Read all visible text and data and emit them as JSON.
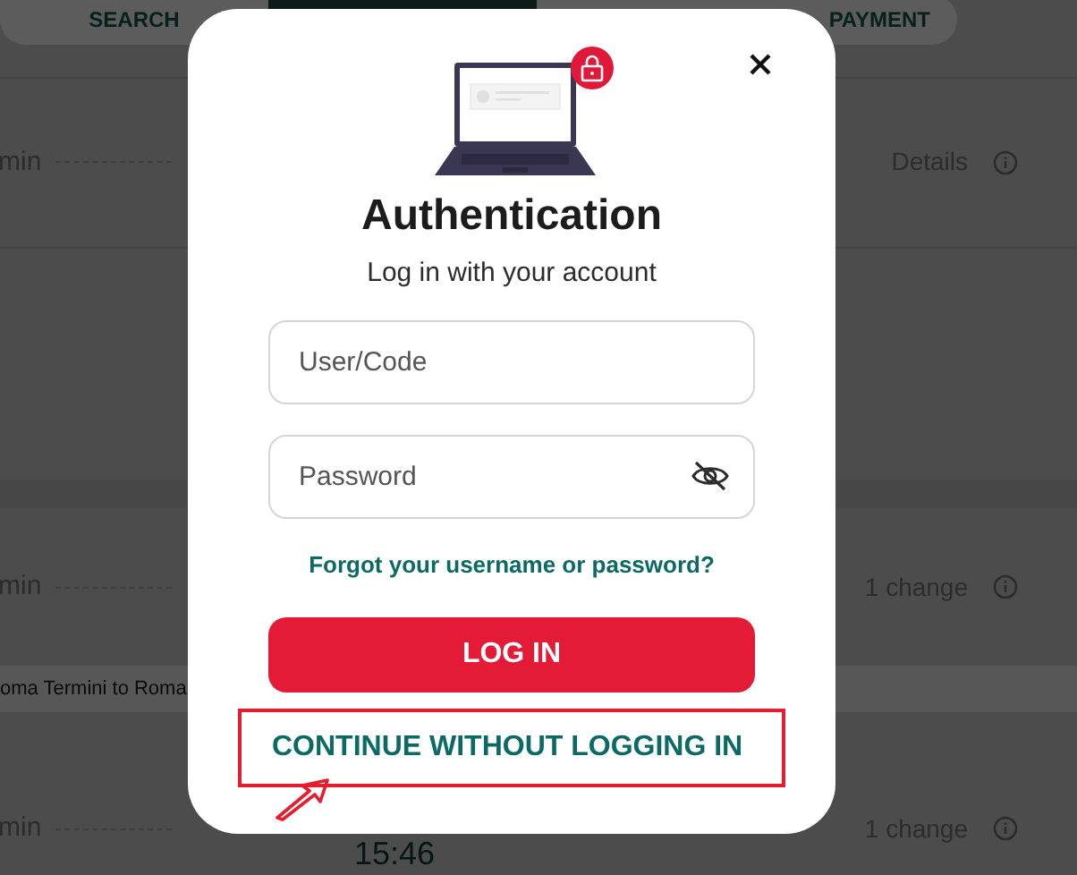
{
  "background": {
    "tabs": [
      {
        "label": "SEARCH"
      },
      {
        "label": "PAYMENT"
      }
    ],
    "rows": [
      {
        "duration": "min",
        "info": "Details"
      },
      {
        "duration": "min",
        "info": "1 change",
        "banner": "oma Termini to Roma"
      },
      {
        "duration": "min",
        "info": "1 change",
        "time": "15:46"
      }
    ]
  },
  "dialog": {
    "title": "Authentication",
    "subtitle": "Log in with your account",
    "fields": [
      {
        "placeholder": "User/Code",
        "kind": "text"
      },
      {
        "placeholder": "Password",
        "kind": "password"
      }
    ],
    "forgot_link": "Forgot your username or password?",
    "login_button": "LOG IN",
    "continue_link": "CONTINUE WITHOUT LOGGING IN"
  }
}
